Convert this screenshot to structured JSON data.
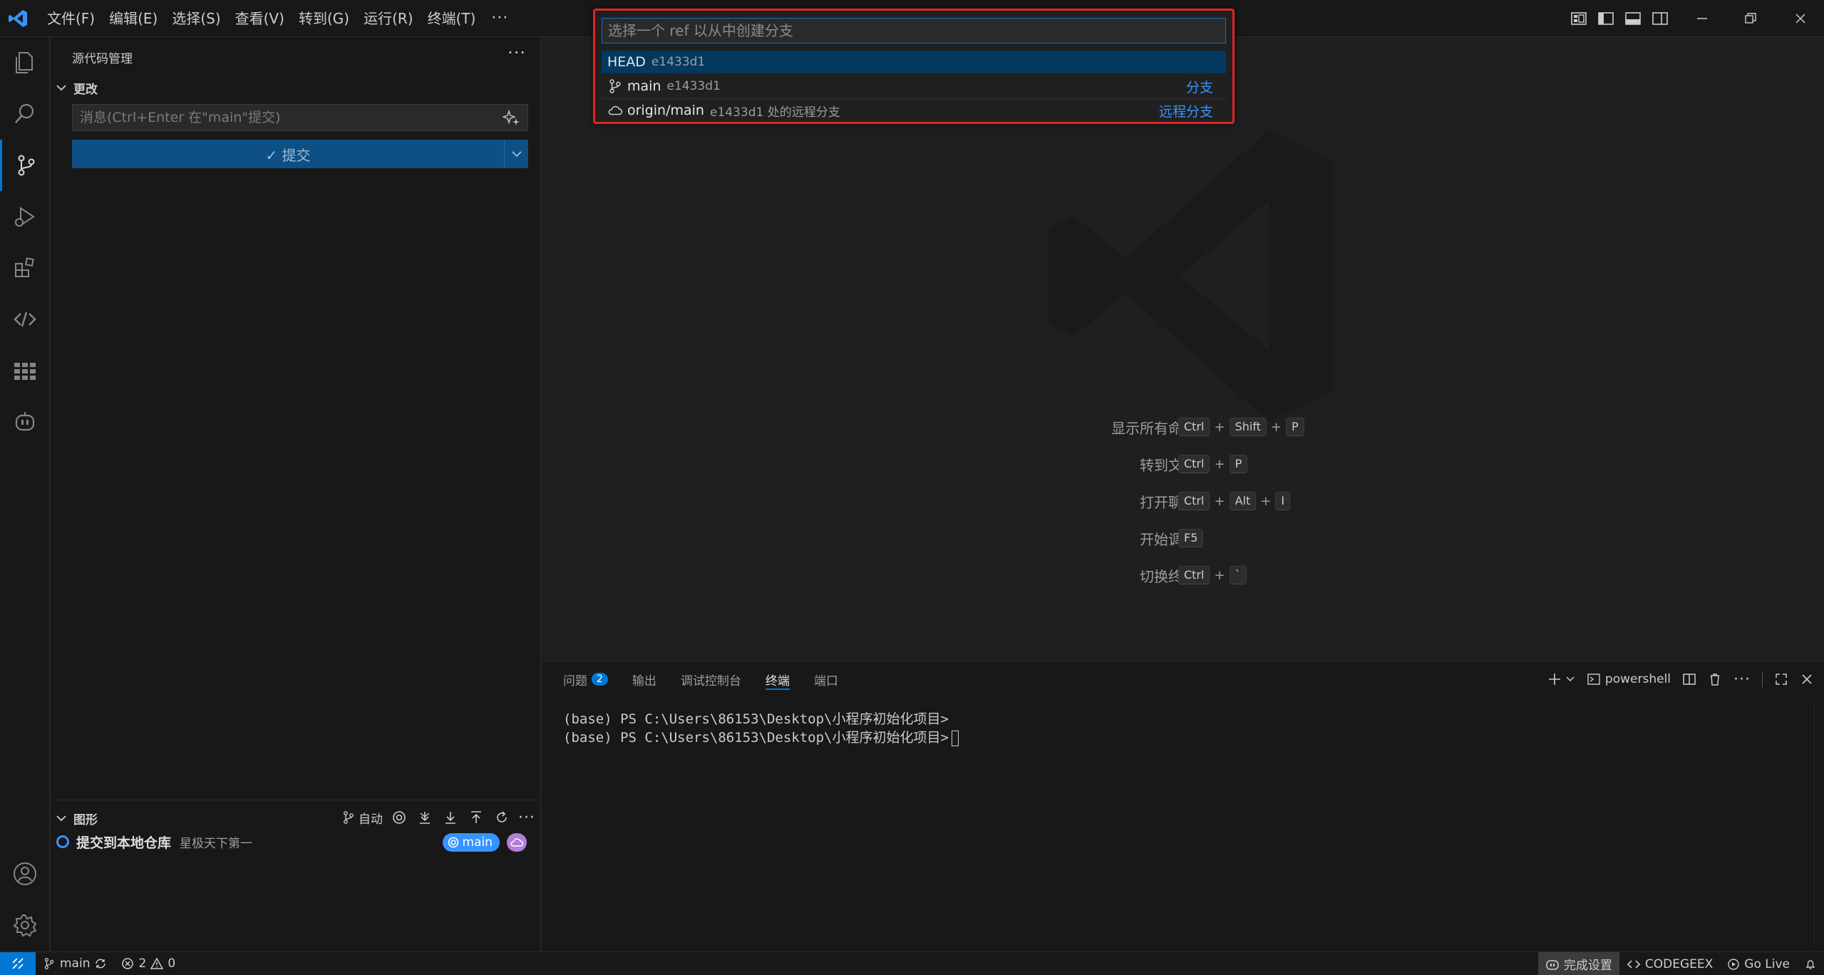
{
  "menubar": {
    "items": [
      "文件(F)",
      "编辑(E)",
      "选择(S)",
      "查看(V)",
      "转到(G)",
      "运行(R)",
      "终端(T)"
    ],
    "more": "···"
  },
  "sidebar": {
    "title": "源代码管理",
    "more": "···",
    "changes_label": "更改",
    "commit_placeholder": "消息(Ctrl+Enter 在\"main\"提交)",
    "commit_label": "✓ 提交",
    "graph": {
      "title": "图形",
      "auto_label": "自动",
      "more": "···",
      "commit_message": "提交到本地仓库",
      "commit_author": "星极天下第一",
      "branch": "main"
    }
  },
  "quickpick": {
    "placeholder": "选择一个 ref 以从中创建分支",
    "items": [
      {
        "name": "HEAD",
        "desc": "e1433d1",
        "tag": ""
      },
      {
        "name": "main",
        "desc": "e1433d1",
        "tag": "分支"
      },
      {
        "name": "origin/main",
        "desc": "e1433d1 处的远程分支",
        "tag": "远程分支"
      }
    ]
  },
  "shortcuts": [
    {
      "label": "显示所有命令",
      "keys": [
        "Ctrl",
        "Shift",
        "P"
      ]
    },
    {
      "label": "转到文件",
      "keys": [
        "Ctrl",
        "P"
      ]
    },
    {
      "label": "打开聊天",
      "keys": [
        "Ctrl",
        "Alt",
        "I"
      ]
    },
    {
      "label": "开始调试",
      "keys": [
        "F5"
      ]
    },
    {
      "label": "切换终端",
      "keys": [
        "Ctrl",
        "`"
      ]
    }
  ],
  "panel": {
    "tabs": {
      "problems": "问题",
      "problems_count": "2",
      "output": "输出",
      "debug_console": "调试控制台",
      "terminal": "终端",
      "ports": "端口"
    },
    "shell": "powershell",
    "terminal_lines": [
      "(base) PS C:\\Users\\86153\\Desktop\\小程序初始化项目>",
      "(base) PS C:\\Users\\86153\\Desktop\\小程序初始化项目>"
    ]
  },
  "statusbar": {
    "branch": "main",
    "errors": "2",
    "warnings": "0",
    "setup": "完成设置",
    "codegeex": "CODEGEEX",
    "golive": "Go Live"
  },
  "colors": {
    "accent": "#0078d4",
    "highlight_border": "#e02424",
    "link": "#3794ff",
    "selection": "#04395e"
  }
}
